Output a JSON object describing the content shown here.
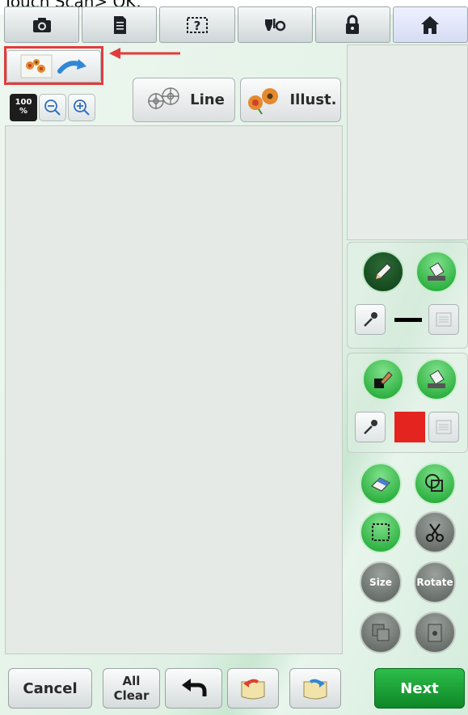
{
  "caption": "Touch Scan> OK.",
  "top_tabs": [
    {
      "name": "camera",
      "icon": "camera-icon"
    },
    {
      "name": "document",
      "icon": "document-icon"
    },
    {
      "name": "help",
      "icon": "help-icon"
    },
    {
      "name": "needle-change",
      "icon": "needle-change-icon"
    },
    {
      "name": "lock",
      "icon": "lock-icon"
    },
    {
      "name": "home",
      "icon": "home-icon"
    }
  ],
  "zoom": {
    "value": "100",
    "unit": "%"
  },
  "mode_buttons": {
    "line": "Line",
    "illust": "Illust."
  },
  "side_panel": {
    "line_color": "#000000",
    "fill_color": "#e3241f",
    "size_label": "Size",
    "rotate_label": "Rotate"
  },
  "bottom": {
    "cancel": "Cancel",
    "all_clear_1": "All",
    "all_clear_2": "Clear",
    "next": "Next"
  },
  "highlight_color": "#e33b3b"
}
